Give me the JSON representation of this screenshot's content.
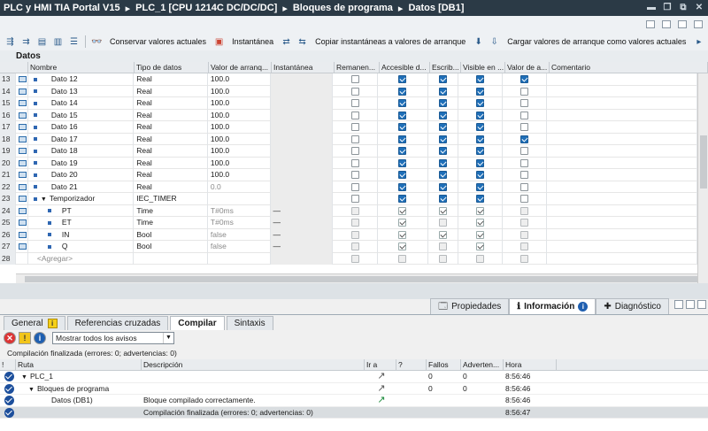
{
  "titlebar": {
    "app": "PLC y HMI TIA Portal V15",
    "crumbs": [
      "PLC_1 [CPU 1214C DC/DC/DC]",
      "Bloques de programa",
      "Datos [DB1]"
    ],
    "sep": "▸"
  },
  "toolbar": {
    "keep_actual": "Conservar valores actuales",
    "snapshot": "Instantánea",
    "copy_snapshots": "Copiar instantáneas a valores de arranque",
    "load_start": "Cargar valores de arranque como valores actuales",
    "more": "▸"
  },
  "editor": {
    "title": "Datos",
    "columns": [
      "Nombre",
      "Tipo de datos",
      "Valor de arranq...",
      "Instantánea",
      "Remanen...",
      "Accesible d...",
      "Escrib...",
      "Visible en ...",
      "Valor de a...",
      "Comentario"
    ],
    "rows": [
      {
        "num": "13",
        "name": "Dato 12",
        "type": "Real",
        "value": "100.0",
        "snap": "",
        "rem": false,
        "acc": true,
        "esc": true,
        "vis": true,
        "va": true
      },
      {
        "num": "14",
        "name": "Dato 13",
        "type": "Real",
        "value": "100.0",
        "snap": "",
        "rem": false,
        "acc": true,
        "esc": true,
        "vis": true,
        "va": false
      },
      {
        "num": "15",
        "name": "Dato 14",
        "type": "Real",
        "value": "100.0",
        "snap": "",
        "rem": false,
        "acc": true,
        "esc": true,
        "vis": true,
        "va": false
      },
      {
        "num": "16",
        "name": "Dato 15",
        "type": "Real",
        "value": "100.0",
        "snap": "",
        "rem": false,
        "acc": true,
        "esc": true,
        "vis": true,
        "va": false
      },
      {
        "num": "17",
        "name": "Dato 16",
        "type": "Real",
        "value": "100.0",
        "snap": "",
        "rem": false,
        "acc": true,
        "esc": true,
        "vis": true,
        "va": false
      },
      {
        "num": "18",
        "name": "Dato 17",
        "type": "Real",
        "value": "100.0",
        "snap": "",
        "rem": false,
        "acc": true,
        "esc": true,
        "vis": true,
        "va": true
      },
      {
        "num": "19",
        "name": "Dato 18",
        "type": "Real",
        "value": "100.0",
        "snap": "",
        "rem": false,
        "acc": true,
        "esc": true,
        "vis": true,
        "va": false
      },
      {
        "num": "20",
        "name": "Dato 19",
        "type": "Real",
        "value": "100.0",
        "snap": "",
        "rem": false,
        "acc": true,
        "esc": true,
        "vis": true,
        "va": false
      },
      {
        "num": "21",
        "name": "Dato 20",
        "type": "Real",
        "value": "100.0",
        "snap": "",
        "rem": false,
        "acc": true,
        "esc": true,
        "vis": true,
        "va": false
      },
      {
        "num": "22",
        "name": "Dato 21",
        "type": "Real",
        "value": "0.0",
        "snap": "",
        "rem": false,
        "acc": true,
        "esc": true,
        "vis": true,
        "va": false
      },
      {
        "num": "23",
        "name": "Temporizador",
        "type": "IEC_TIMER",
        "value": "",
        "snap": "",
        "rem": false,
        "acc": true,
        "esc": true,
        "vis": true,
        "va": false
      },
      {
        "num": "24",
        "name": "PT",
        "type": "Time",
        "value": "T#0ms",
        "snap": "—",
        "rem": false,
        "acc": true,
        "esc": true,
        "vis": true,
        "va": false
      },
      {
        "num": "25",
        "name": "ET",
        "type": "Time",
        "value": "T#0ms",
        "snap": "—",
        "rem": false,
        "acc": true,
        "esc": false,
        "vis": true,
        "va": false
      },
      {
        "num": "26",
        "name": "IN",
        "type": "Bool",
        "value": "false",
        "snap": "—",
        "rem": false,
        "acc": true,
        "esc": true,
        "vis": true,
        "va": false
      },
      {
        "num": "27",
        "name": "Q",
        "type": "Bool",
        "value": "false",
        "snap": "—",
        "rem": false,
        "acc": true,
        "esc": false,
        "vis": true,
        "va": false
      },
      {
        "num": "28",
        "name": "<Agregar>",
        "type": "",
        "value": "",
        "snap": "",
        "rem": false,
        "acc": false,
        "esc": false,
        "vis": false,
        "va": false
      }
    ]
  },
  "panel_tabs": {
    "props": "Propiedades",
    "info": "Información",
    "diag": "Diagnóstico",
    "info_badge": "i"
  },
  "sub_tabs": {
    "general": "General",
    "refs": "Referencias cruzadas",
    "compile": "Compilar",
    "syntax": "Sintaxis",
    "general_badge": "i"
  },
  "filter": {
    "selected": "Mostrar todos los avisos",
    "btn_error": "✕",
    "btn_warn": "!",
    "btn_info": "i"
  },
  "compile": {
    "status": "Compilación finalizada (errores: 0; advertencias: 0)",
    "columns": [
      "!",
      "Ruta",
      "Descripción",
      "Ir a",
      "?",
      "Fallos",
      "Adverten...",
      "Hora"
    ],
    "rows": [
      {
        "ruta": "PLC_1",
        "desc": "",
        "fallos": "0",
        "adv": "0",
        "hora": "8:56:46",
        "goto": "↗"
      },
      {
        "ruta": "Bloques de programa",
        "desc": "",
        "fallos": "0",
        "adv": "0",
        "hora": "8:56:46",
        "goto": "↗"
      },
      {
        "ruta": "Datos (DB1)",
        "desc": "Bloque compilado correctamente.",
        "fallos": "",
        "adv": "",
        "hora": "8:56:46",
        "goto": "↗"
      },
      {
        "ruta": "",
        "desc": "Compilación finalizada (errores: 0; advertencias: 0)",
        "fallos": "",
        "adv": "",
        "hora": "8:56:47",
        "goto": ""
      }
    ]
  }
}
